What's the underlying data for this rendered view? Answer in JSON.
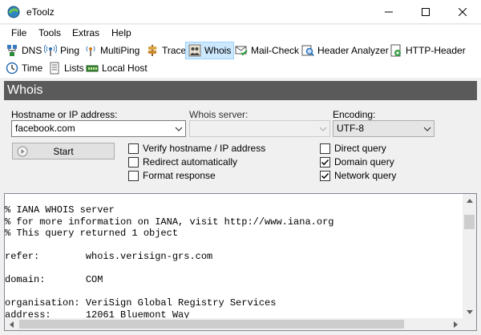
{
  "window": {
    "title": "eToolz"
  },
  "menu": [
    "File",
    "Tools",
    "Extras",
    "Help"
  ],
  "toolbar": {
    "row1": [
      "DNS",
      "Ping",
      "MultiPing",
      "Trace",
      "Whois",
      "Mail-Check",
      "Header Analyzer",
      "HTTP-Header"
    ],
    "row2": [
      "Time",
      "Lists",
      "Local Host"
    ],
    "selected": "Whois"
  },
  "section": {
    "title": "Whois"
  },
  "form": {
    "host_label": "Hostname or IP address:",
    "host_value": "facebook.com",
    "server_label": "Whois server:",
    "server_value": "",
    "encoding_label": "Encoding:",
    "encoding_value": "UTF-8",
    "start_label": "Start"
  },
  "options": {
    "verify": {
      "label": "Verify hostname / IP address",
      "checked": false
    },
    "redirect": {
      "label": "Redirect automatically",
      "checked": false
    },
    "format": {
      "label": "Format response",
      "checked": false
    },
    "direct": {
      "label": "Direct query",
      "checked": false
    },
    "domain": {
      "label": "Domain query",
      "checked": true
    },
    "network": {
      "label": "Network query",
      "checked": true
    }
  },
  "output": {
    "lines": [
      "% IANA WHOIS server",
      "% for more information on IANA, visit http://www.iana.org",
      "% This query returned 1 object",
      "",
      "refer:        whois.verisign-grs.com",
      "",
      "domain:       COM",
      "",
      "organisation: VeriSign Global Registry Services",
      "address:      12061 Bluemont Way"
    ]
  },
  "colors": {
    "selected_bg": "#cce8ff",
    "section_bg": "#5a5a5a"
  }
}
